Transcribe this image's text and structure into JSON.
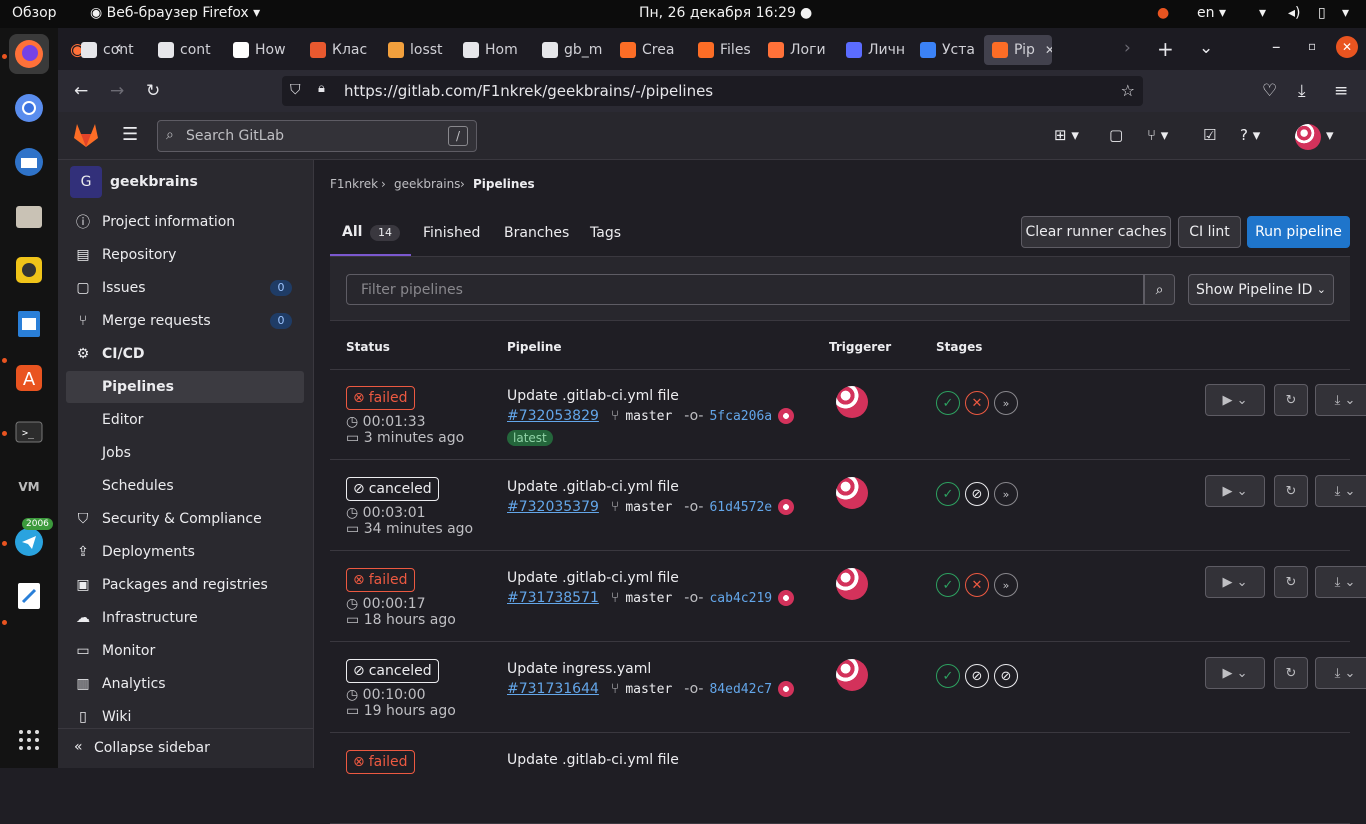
{
  "topbar": {
    "activities": "Обзор",
    "app_name": "Веб-браузер Firefox",
    "clock": "Пн, 26 декабря  16:29",
    "lang": "en"
  },
  "browser": {
    "tabs": [
      {
        "label": "cont",
        "color": "#e6e6ea"
      },
      {
        "label": "cont",
        "color": "#e6e6ea"
      },
      {
        "label": "How",
        "color": "#ffffff"
      },
      {
        "label": "Клас",
        "color": "#e8592f"
      },
      {
        "label": "losst",
        "color": "#f2a03d"
      },
      {
        "label": "Hom",
        "color": "#e6e6ea"
      },
      {
        "label": "gb_m",
        "color": "#e6e6ea"
      },
      {
        "label": "Crea",
        "color": "#fc6d26"
      },
      {
        "label": "Files",
        "color": "#fc6d26"
      },
      {
        "label": "Логи",
        "color": "#ff7139"
      },
      {
        "label": "Личн",
        "color": "#5b6cff"
      },
      {
        "label": "Уста",
        "color": "#3b82f6"
      },
      {
        "label": "Pip",
        "color": "#fc6d26"
      }
    ],
    "url": "https://gitlab.com/F1nkrek/geekbrains/-/pipelines"
  },
  "header": {
    "search_placeholder": "Search GitLab",
    "search_shortcut": "/"
  },
  "sidebar": {
    "project_initial": "G",
    "project_name": "geekbrains",
    "items": [
      {
        "label": "Project information",
        "icon": "info-icon"
      },
      {
        "label": "Repository",
        "icon": "doc-icon"
      },
      {
        "label": "Issues",
        "icon": "issues-icon",
        "count": "0"
      },
      {
        "label": "Merge requests",
        "icon": "merge-icon",
        "count": "0"
      },
      {
        "label": "CI/CD",
        "icon": "rocket-icon"
      },
      {
        "label": "Pipelines"
      },
      {
        "label": "Editor"
      },
      {
        "label": "Jobs"
      },
      {
        "label": "Schedules"
      },
      {
        "label": "Security & Compliance",
        "icon": "shield-icon"
      },
      {
        "label": "Deployments",
        "icon": "deploy-icon"
      },
      {
        "label": "Packages and registries",
        "icon": "package-icon"
      },
      {
        "label": "Infrastructure",
        "icon": "cloud-icon"
      },
      {
        "label": "Monitor",
        "icon": "monitor-icon"
      },
      {
        "label": "Analytics",
        "icon": "chart-icon"
      },
      {
        "label": "Wiki",
        "icon": "book-icon"
      }
    ],
    "collapse": "Collapse sidebar"
  },
  "main": {
    "breadcrumb": [
      "F1nkrek",
      "geekbrains",
      "Pipelines"
    ],
    "tabs": {
      "all": "All",
      "all_count": "14",
      "finished": "Finished",
      "branches": "Branches",
      "tags": "Tags"
    },
    "buttons": {
      "clear_cache": "Clear runner caches",
      "ci_lint": "CI lint",
      "run_pipeline": "Run pipeline"
    },
    "filter_placeholder": "Filter pipelines",
    "show_id": "Show Pipeline ID",
    "columns": {
      "status": "Status",
      "pipeline": "Pipeline",
      "triggerer": "Triggerer",
      "stages": "Stages"
    },
    "pipelines": [
      {
        "status": "failed",
        "duration": "00:01:33",
        "ago": "3 minutes ago",
        "title": "Update .gitlab-ci.yml file",
        "id": "#732053829",
        "branch": "master",
        "sha": "5fca206a",
        "latest": "latest",
        "stages": [
          "ok",
          "fail",
          "skip"
        ]
      },
      {
        "status": "canceled",
        "duration": "00:03:01",
        "ago": "34 minutes ago",
        "title": "Update .gitlab-ci.yml file",
        "id": "#732035379",
        "branch": "master",
        "sha": "61d4572e",
        "stages": [
          "ok",
          "cancel",
          "skip"
        ]
      },
      {
        "status": "failed",
        "duration": "00:00:17",
        "ago": "18 hours ago",
        "title": "Update .gitlab-ci.yml file",
        "id": "#731738571",
        "branch": "master",
        "sha": "cab4c219",
        "stages": [
          "ok",
          "fail",
          "skip"
        ]
      },
      {
        "status": "canceled",
        "duration": "00:10:00",
        "ago": "19 hours ago",
        "title": "Update ingress.yaml",
        "id": "#731731644",
        "branch": "master",
        "sha": "84ed42c7",
        "stages": [
          "ok",
          "cancel",
          "cancel"
        ]
      },
      {
        "status": "failed",
        "title": "Update .gitlab-ci.yml file"
      }
    ]
  },
  "dock": {
    "telegram_badge": "2006"
  }
}
